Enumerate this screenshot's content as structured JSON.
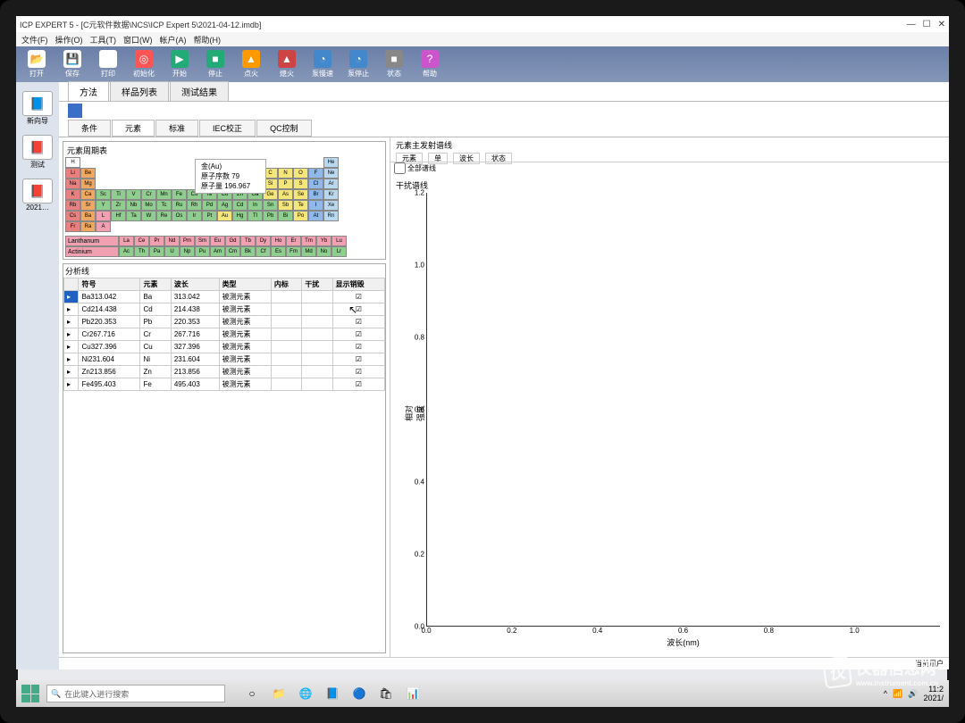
{
  "title": "ICP EXPERT 5 - [C元软件数据\\NCS\\ICP Expert 5\\2021-04-12.imdb]",
  "menu": [
    "文件(F)",
    "操作(O)",
    "工具(T)",
    "窗口(W)",
    "帐户(A)",
    "帮助(H)"
  ],
  "toolbar": [
    {
      "label": "打开",
      "icon": "📂",
      "bg": "#fff"
    },
    {
      "label": "保存",
      "icon": "💾",
      "bg": "#fff"
    },
    {
      "label": "打印",
      "icon": "🖨",
      "bg": "#fff"
    },
    {
      "label": "初始化",
      "icon": "◎",
      "bg": "#f55"
    },
    {
      "label": "开始",
      "icon": "▶",
      "bg": "#2a7"
    },
    {
      "label": "停止",
      "icon": "■",
      "bg": "#2a7"
    },
    {
      "label": "点火",
      "icon": "▲",
      "bg": "#f90"
    },
    {
      "label": "熄火",
      "icon": "▲",
      "bg": "#c44"
    },
    {
      "label": "泵慢速",
      "icon": "◔",
      "bg": "#48c"
    },
    {
      "label": "泵停止",
      "icon": "◔",
      "bg": "#48c"
    },
    {
      "label": "状态",
      "icon": "■",
      "bg": "#888"
    },
    {
      "label": "帮助",
      "icon": "?",
      "bg": "#c5c"
    }
  ],
  "sidebar": [
    {
      "label": "新向导",
      "icon": "📘"
    },
    {
      "label": "测试",
      "icon": "📕"
    },
    {
      "label": "2021…",
      "icon": "📕"
    }
  ],
  "maintabs": [
    "方法",
    "样品列表",
    "测试结果"
  ],
  "subtabs": [
    "条件",
    "元素",
    "标准",
    "IEC校正",
    "QC控制"
  ],
  "ptable": {
    "title": "元素周期表",
    "selected": {
      "sym": "Au",
      "name": "金(Au)",
      "z": "原子序数 79",
      "mass": "原子量  196.967"
    },
    "lan_label": "Lanthanum",
    "act_label": "Actinium"
  },
  "analysis": {
    "title": "分析线",
    "headers": [
      "符号",
      "元素",
      "波长",
      "类型",
      "内标",
      "干扰",
      "显示销毁"
    ],
    "rows": [
      {
        "sym": "Ba313.042",
        "el": "Ba",
        "wl": "313.042",
        "type": "被测元素",
        "chk": true,
        "sel": true
      },
      {
        "sym": "Cd214.438",
        "el": "Cd",
        "wl": "214.438",
        "type": "被测元素",
        "chk": true
      },
      {
        "sym": "Pb220.353",
        "el": "Pb",
        "wl": "220.353",
        "type": "被测元素",
        "chk": true
      },
      {
        "sym": "Cr267.716",
        "el": "Cr",
        "wl": "267.716",
        "type": "被测元素",
        "chk": true
      },
      {
        "sym": "Cu327.396",
        "el": "Cu",
        "wl": "327.396",
        "type": "被测元素",
        "chk": true
      },
      {
        "sym": "Ni231.604",
        "el": "Ni",
        "wl": "231.604",
        "type": "被测元素",
        "chk": true
      },
      {
        "sym": "Zn213.856",
        "el": "Zn",
        "wl": "213.856",
        "type": "被测元素",
        "chk": true
      },
      {
        "sym": "Fe495.403",
        "el": "Fe",
        "wl": "495.403",
        "type": "被测元素",
        "chk": true
      }
    ]
  },
  "right": {
    "emission_title": "元素主发射谱线",
    "cols": [
      "元素",
      "单",
      "波长",
      "状态"
    ],
    "all_lines": "全部谱线",
    "interference": "干扰谱线"
  },
  "chart_data": {
    "type": "line",
    "title": "干扰谱线",
    "xlabel": "波长(nm)",
    "ylabel": "相对强度",
    "xlim": [
      0.0,
      1.2
    ],
    "ylim": [
      0.0,
      1.2
    ],
    "xticks": [
      0.0,
      0.2,
      0.4,
      0.6,
      0.8,
      1.0
    ],
    "yticks": [
      0.0,
      0.2,
      0.4,
      0.6,
      0.8,
      1.0,
      1.2
    ],
    "series": []
  },
  "taskbar": {
    "search": "在此键入进行搜索",
    "clock": "11:2",
    "date": "2021/"
  },
  "watermark": {
    "main": "仪器信息网",
    "sub": "www.instrument.com.cn"
  },
  "status": "当前用户"
}
